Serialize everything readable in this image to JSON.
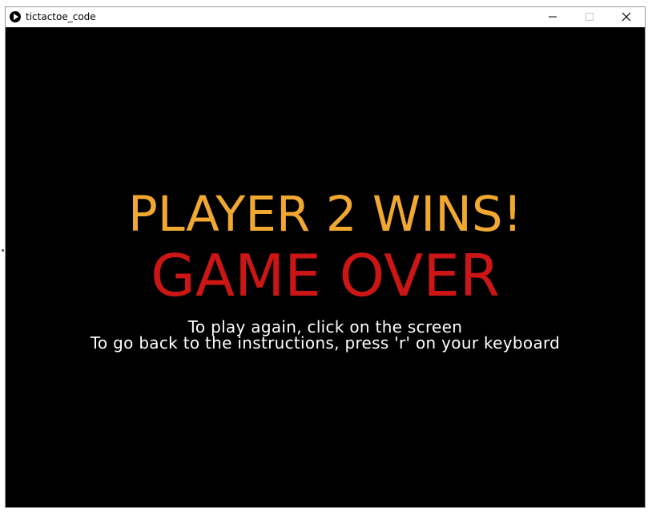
{
  "window": {
    "title": "tictactoe_code",
    "icon": "play-icon",
    "controls": [
      "minimize-icon",
      "maximize-icon",
      "close-icon"
    ]
  },
  "game": {
    "result": "PLAYER 2 WINS!",
    "status": "GAME OVER",
    "instruction_line1": "To play again, click on the screen",
    "instruction_line2": "To go back to the instructions, press 'r' on your keyboard"
  },
  "colors": {
    "background": "#000000",
    "result": "#f0a830",
    "status": "#cc1616",
    "instructions": "#ffffff"
  }
}
